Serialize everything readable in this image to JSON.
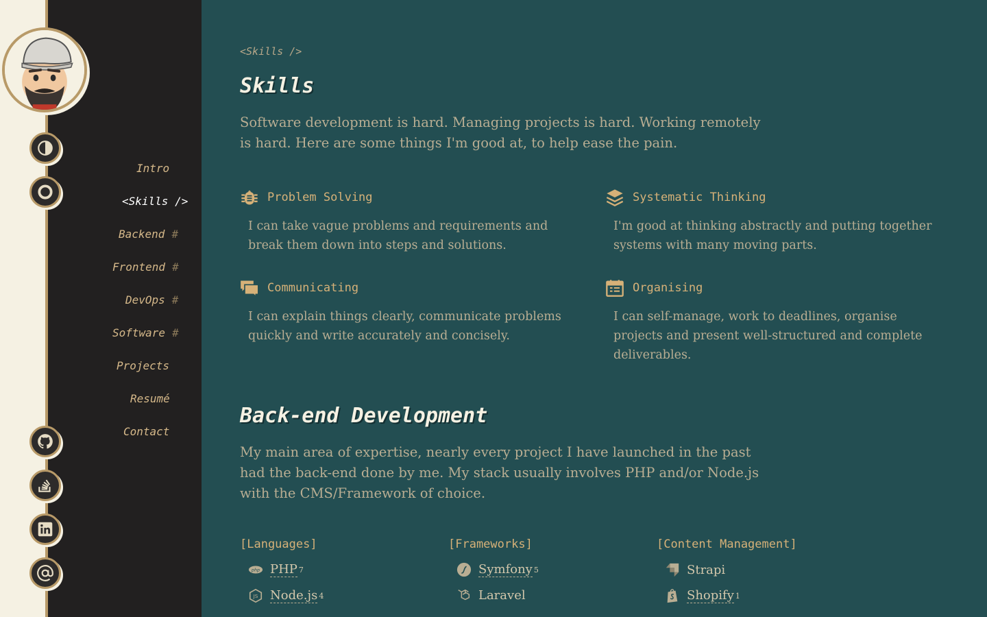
{
  "sidebar": {
    "nav": [
      {
        "label": "Intro",
        "hash": ""
      },
      {
        "label": "<Skills />",
        "hash": ""
      },
      {
        "label": "Backend",
        "hash": "#"
      },
      {
        "label": "Frontend",
        "hash": "#"
      },
      {
        "label": "DevOps",
        "hash": "#"
      },
      {
        "label": "Software",
        "hash": "#"
      },
      {
        "label": "Projects",
        "hash": ""
      },
      {
        "label": "Resumé",
        "hash": ""
      },
      {
        "label": "Contact",
        "hash": ""
      }
    ],
    "active_index": 1,
    "top_buttons": [
      "contrast-icon",
      "circle-icon"
    ],
    "social_buttons": [
      "github-icon",
      "stackoverflow-icon",
      "linkedin-icon",
      "at-sign-icon"
    ]
  },
  "main": {
    "breadcrumb": "<Skills />",
    "title": "Skills",
    "intro": "Software development is hard. Managing projects is hard. Working remotely is hard. Here are some things I'm good at, to help ease the pain.",
    "skills": [
      {
        "title": "Problem Solving",
        "icon": "bug-icon",
        "desc": "I can take vague problems and requirements and break them down into steps and solutions."
      },
      {
        "title": "Systematic Thinking",
        "icon": "layers-icon",
        "desc": "I'm good at thinking abstractly and putting together systems with many moving parts."
      },
      {
        "title": "Communicating",
        "icon": "chat-icon",
        "desc": "I can explain things clearly, communicate problems quickly and write accurately and concisely."
      },
      {
        "title": "Organising",
        "icon": "calendar-icon",
        "desc": "I can self-manage, work to deadlines, organise projects and present well-structured and complete deliverables."
      }
    ],
    "backend": {
      "title": "Back-end Development",
      "intro": "My main area of expertise, nearly every project I have launched in the past had the back-end done by me. My stack usually involves PHP and/or Node.js with the CMS/Framework of choice.",
      "categories": [
        {
          "label": "[Languages]",
          "items": [
            {
              "name": "PHP",
              "count": "7",
              "icon": "php-icon"
            },
            {
              "name": "Node.js",
              "count": "4",
              "icon": "nodejs-icon"
            }
          ]
        },
        {
          "label": "[Frameworks]",
          "items": [
            {
              "name": "Symfony",
              "count": "5",
              "icon": "symfony-icon"
            },
            {
              "name": "Laravel",
              "count": "",
              "icon": "laravel-icon"
            }
          ]
        },
        {
          "label": "[Content Management]",
          "items": [
            {
              "name": "Strapi",
              "count": "",
              "icon": "strapi-icon"
            },
            {
              "name": "Shopify",
              "count": "1",
              "icon": "shopify-icon"
            }
          ]
        }
      ]
    }
  },
  "colors": {
    "sidebar_bg": "#222020",
    "main_bg": "#234e52",
    "accent": "#d6b178",
    "cream": "#f5f1e3"
  }
}
